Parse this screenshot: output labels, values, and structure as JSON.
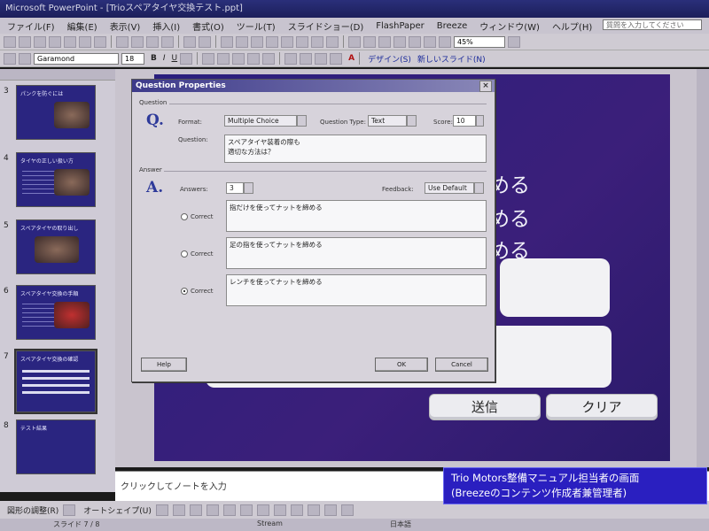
{
  "window": {
    "title": "Microsoft PowerPoint - [Trioスペアタイヤ交換テスト.ppt]"
  },
  "menu": [
    "ファイル(F)",
    "編集(E)",
    "表示(V)",
    "挿入(I)",
    "書式(O)",
    "ツール(T)",
    "スライドショー(D)",
    "FlashPaper",
    "Breeze",
    "ウィンドウ(W)",
    "ヘルプ(H)"
  ],
  "help_box": "質問を入力してください",
  "toolbar1": {
    "zoom": "45%"
  },
  "toolbar2": {
    "font": "Garamond",
    "size": "18",
    "bold": "B",
    "italic": "I",
    "underline": "U",
    "font_color": "A",
    "design": "デザイン(S)",
    "new_slide": "新しいスライド(N)"
  },
  "slides": [
    {
      "num": "3",
      "title": "パンクを防ぐには"
    },
    {
      "num": "4",
      "title": "タイヤの正しい扱い方"
    },
    {
      "num": "5",
      "title": "スペアタイヤの取り出し"
    },
    {
      "num": "6",
      "title": "スペアタイヤ交換の手順"
    },
    {
      "num": "7",
      "title": "スペアタイヤ交換の確認"
    },
    {
      "num": "8",
      "title": "テスト結果"
    }
  ],
  "slide": {
    "options": [
      "める",
      "める",
      "める"
    ],
    "submit_label": "送信",
    "clear_label": "クリア"
  },
  "notes_placeholder": "クリックしてノートを入力",
  "status": {
    "slide": "スライド 7 / 8",
    "template": "Stream",
    "lang": "日本語"
  },
  "drawing_toolbar": {
    "draw": "図形の調整(R)",
    "autoshape": "オートシェイプ(U)"
  },
  "caption": {
    "line1": "Trio Motors整備マニュアル担当者の画面",
    "line2": "(Breezeのコンテンツ作成者兼管理者)"
  },
  "dialog": {
    "title": "Question Properties",
    "section_question": "Question",
    "section_answer": "Answer",
    "q_letter": "Q.",
    "a_letter": "A.",
    "format_label": "Format:",
    "format_value": "Multiple Choice",
    "qtype_label": "Question Type:",
    "qtype_value": "Text",
    "score_label": "Score:",
    "score_value": "10",
    "question_label": "Question:",
    "question_line1": "スペアタイヤ装着の際も",
    "question_line2": "適切な方法は？",
    "answers_label": "Answers:",
    "answers_value": "3",
    "feedback_label": "Feedback:",
    "feedback_value": "Use Default",
    "correct_label": "Correct",
    "answers": [
      {
        "text": "指だけを使ってナットを締める",
        "selected": false
      },
      {
        "text": "足の指を使ってナットを締める",
        "selected": false
      },
      {
        "text": "レンチを使ってナットを締める",
        "selected": true
      }
    ],
    "help_button": "Help",
    "ok_button": "OK",
    "cancel_button": "Cancel"
  }
}
